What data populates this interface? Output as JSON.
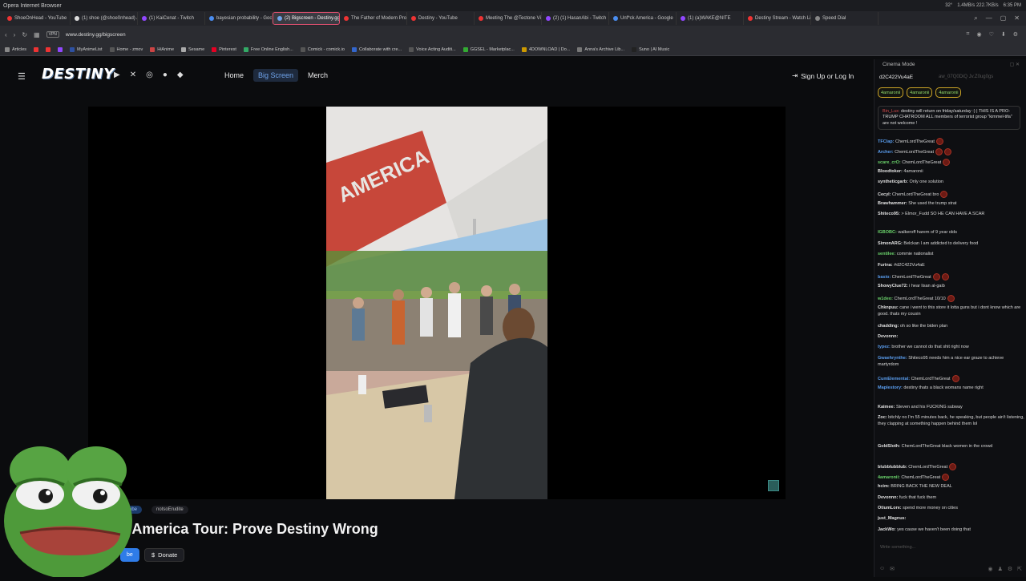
{
  "browser": {
    "app_title": "Opera Internet Browser",
    "tray": [
      "32°",
      "1.4MB/s 222.7KB/s",
      "6:35 PM"
    ],
    "tabs": [
      {
        "label": "ShoeOnHead - YouTube",
        "color": "#e33"
      },
      {
        "label": "(1) shoe (@shoe0nhead) /",
        "color": "#ddd"
      },
      {
        "label": "(1) KaiCenat - Twitch",
        "color": "#9147ff"
      },
      {
        "label": "bayesian probability - Goo",
        "color": "#4a8df0"
      },
      {
        "label": "(2) Bigscreen - Destiny.gg",
        "color": "#6fa3ea",
        "active": true
      },
      {
        "label": "The Father of Modern Pro",
        "color": "#e33"
      },
      {
        "label": "Destiny - YouTube",
        "color": "#e33"
      },
      {
        "label": "Meeting The @Tectone Vi",
        "color": "#e33"
      },
      {
        "label": "(2) (1) HasanAbi - Twitch",
        "color": "#9147ff"
      },
      {
        "label": "Unf*ck America - Google",
        "color": "#4a8df0"
      },
      {
        "label": "(1) (a)WAKE@NITE",
        "color": "#9147ff"
      },
      {
        "label": "Destiny Stream - Watch Li",
        "color": "#e33"
      },
      {
        "label": "Speed Dial",
        "color": "#888"
      }
    ],
    "url": "www.destiny.gg/bigscreen",
    "vpn": "VPN",
    "bookmarks": [
      {
        "label": "Articles",
        "color": "#888"
      },
      {
        "label": "",
        "color": "#e33"
      },
      {
        "label": "",
        "color": "#e33"
      },
      {
        "label": "",
        "color": "#9147ff"
      },
      {
        "label": "MyAnimeList",
        "color": "#2e51a2"
      },
      {
        "label": "Home - zmov",
        "color": "#555"
      },
      {
        "label": "HiAnime",
        "color": "#c44"
      },
      {
        "label": "Sesame",
        "color": "#aaa"
      },
      {
        "label": "Pinterest",
        "color": "#e60023"
      },
      {
        "label": "Free Online English...",
        "color": "#3a6"
      },
      {
        "label": "Comick - comick.io",
        "color": "#555"
      },
      {
        "label": "Collaborate with cre...",
        "color": "#36c"
      },
      {
        "label": "Voice Acting Auditi...",
        "color": "#555"
      },
      {
        "label": "GGSEL - Marketplac...",
        "color": "#3a3"
      },
      {
        "label": "4DOWNLOAD | Do...",
        "color": "#c90"
      },
      {
        "label": "Anna's Archive Lib...",
        "color": "#777"
      },
      {
        "label": "Suno | AI Music",
        "color": "#222"
      }
    ]
  },
  "site": {
    "logo": "DESTINY",
    "nav": [
      "Home",
      "Big Screen",
      "Merch"
    ],
    "active_nav": "Big Screen",
    "signin": "Sign Up or Log In",
    "social_icons": [
      "youtube-icon",
      "x-icon",
      "instagram-icon",
      "reddit-icon",
      "discord-icon"
    ]
  },
  "video": {
    "tags": [
      "ube",
      "notsoErudite"
    ],
    "title": "k America Tour: Prove Destiny Wrong",
    "subscribe_label": "be",
    "donate_label": "Donate"
  },
  "chat": {
    "cinema_mode": "Cinema Mode",
    "current_user": "d2C422Vu4aE",
    "current_user_dim": "aw_07Q0DiQ        Jv.Z0ug0gs",
    "pinned": [
      "4amaronii",
      "4amaronii",
      "4amaronii"
    ],
    "motd_nick": "Bin_Lux:",
    "motd_text": "destiny will return on friday/saturday :) | THIS IS A PRO-TRUMP CHATROOM ALL members of terrorist group \"kimmel-tifa\" are not welcome !",
    "messages": [
      {
        "nick": "TFClap:",
        "text": "ChemLordTheGreat",
        "color": "#5a9ef0",
        "emotes": 1
      },
      {
        "nick": "Archer:",
        "text": "ChemLordTheGreat",
        "color": "#5a9ef0",
        "emotes": 2
      },
      {
        "nick": "scare_crO:",
        "text": "ChemLordTheGreat",
        "color": "#6bd36b",
        "emotes": 1
      },
      {
        "nick": "Bloodtoker:",
        "text": "4amaronii",
        "color": "#e0e0e0",
        "emotes": 0
      },
      {
        "nick": "syntheticgarb:",
        "text": "Only one solution",
        "color": "#e0e0e0",
        "emotes": 0
      },
      {
        "nick": "Cecyl:",
        "text": "ChemLordTheGreat bro",
        "color": "#e0e0e0",
        "emotes": 1
      },
      {
        "nick": "Brawhammer:",
        "text": "She used the trump strat",
        "color": "#e0e0e0",
        "emotes": 0
      },
      {
        "nick": "Shiteco95:",
        "text": "> Elmor_Fudd SO HE CAN HAVE A SCAR",
        "color": "#e0e0e0",
        "emotes": 0
      },
      {
        "nick": "IGBOBC:",
        "text": "walkeroff harem of 9 year olds",
        "color": "#6bd36b",
        "emotes": 0
      },
      {
        "nick": "SimonARG:",
        "text": "Belckan I am addicted to delivery food",
        "color": "#e0e0e0",
        "emotes": 0
      },
      {
        "nick": "sentilee:",
        "text": "commie nationalist",
        "color": "#6bd36b",
        "emotes": 0
      },
      {
        "nick": "Furina:",
        "text": "#d2C422Vu4aE",
        "color": "#e0e0e0",
        "emotes": 0
      },
      {
        "nick": "basio:",
        "text": "ChemLordTheGreat",
        "color": "#5a9ef0",
        "emotes": 2
      },
      {
        "nick": "ShowyClue72:",
        "text": "i hear lisan al-gaib",
        "color": "#e0e0e0",
        "emotes": 0
      },
      {
        "nick": "w1deo:",
        "text": "ChemLordTheGreat   10/10",
        "color": "#6bd36b",
        "emotes": 1
      },
      {
        "nick": "Chknpuu:",
        "text": "cane i went to this store it lotta guns but i dont know which are good. thats my cousin",
        "color": "#e0e0e0",
        "emotes": 0
      },
      {
        "nick": "chadding:",
        "text": "oh so like the biden plan",
        "color": "#e0e0e0",
        "emotes": 0
      },
      {
        "nick": "Devonnn:",
        "text": "",
        "color": "#e0e0e0",
        "emotes": 0
      },
      {
        "nick": "typez:",
        "text": "brother we cannot do that shit right now",
        "color": "#5a9ef0",
        "emotes": 0
      },
      {
        "nick": "Gwaehrynthe:",
        "text": "Shiteco95 needs him a nice ear graze to achieve martyrdom",
        "color": "#5a9ef0",
        "emotes": 0
      },
      {
        "nick": "CumElemental:",
        "text": "ChemLordTheGreat",
        "color": "#5a9ef0",
        "emotes": 1
      },
      {
        "nick": "Maplestory:",
        "text": "destiny        thats a black womans name right",
        "color": "#5a9ef0",
        "emotes": 0
      },
      {
        "nick": "Kaimee:",
        "text": "Steven and his FUCKING subway",
        "color": "#e0e0e0",
        "emotes": 0
      },
      {
        "nick": "Zoc:",
        "text": "bitchly no I'm 55 minutes back, he speaking, but people ain't listening, they clapping at something happen behind them lol",
        "color": "#e0e0e0",
        "emotes": 0
      },
      {
        "nick": "GoldSloth:",
        "text": "ChemLordTheGreat black women in the crowd",
        "color": "#e0e0e0",
        "emotes": 0
      },
      {
        "nick": "blubblubblub:",
        "text": "ChemLordTheGreat",
        "color": "#e0e0e0",
        "emotes": 1
      },
      {
        "nick": "4amaronii:",
        "text": "ChemLordTheGreat",
        "color": "#6bd36b",
        "emotes": 1
      },
      {
        "nick": "hcim:",
        "text": "BRING BACK THE NEW DEAL",
        "color": "#e0e0e0",
        "emotes": 0
      },
      {
        "nick": "Devonnn:",
        "text": "fuck that fuck them",
        "color": "#e0e0e0",
        "emotes": 0
      },
      {
        "nick": "OtiumLore:",
        "text": "spend more money on cities",
        "color": "#e0e0e0",
        "emotes": 0
      },
      {
        "nick": "just_Magnus:",
        "text": "",
        "color": "#e0e0e0",
        "emotes": 0
      },
      {
        "nick": "JackWo:",
        "text": "yes cause we haven't been doing that",
        "color": "#e0e0e0",
        "emotes": 0
      }
    ],
    "input_placeholder": "Write something..."
  }
}
